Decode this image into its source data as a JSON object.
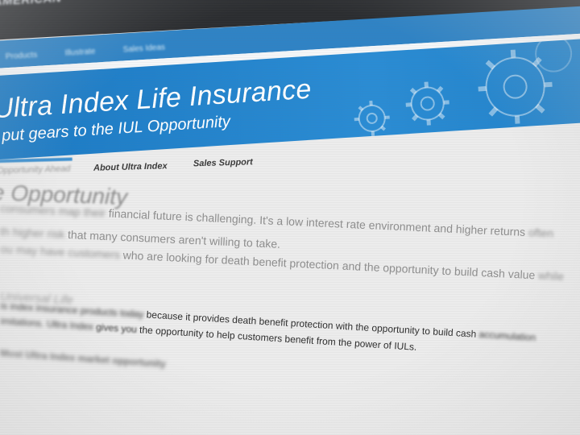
{
  "brand": {
    "logo_text": "AMERICAN"
  },
  "nav": {
    "items": [
      "Products",
      "Illustrate",
      "Sales Ideas"
    ]
  },
  "hero": {
    "title": "Ultra Index Life Insurance",
    "subtitle": "put gears to the IUL Opportunity"
  },
  "tabs": [
    {
      "label": "Opportunity Ahead",
      "active": true
    },
    {
      "label": "About Ultra Index",
      "active": false
    },
    {
      "label": "Sales Support",
      "active": false
    }
  ],
  "content": {
    "heading": "e Opportunity",
    "para1_lead": "consumers map their",
    "para1_main": " financial future is challenging. It's a low interest rate environment and higher returns",
    "para1_tail": " often",
    "para2_lead": "th higher risk",
    "para2_main": " that many consumers aren't willing to take.",
    "para3_lead": "ou may have customers",
    "para3_main": " who are looking for death benefit protection and the opportunity to build cash value",
    "para3_tail": " while",
    "subheading": "Universal Life",
    "para4_lead": "is index insurance products today",
    "para4_main": " because it provides death benefit protection with the opportunity to build cash ",
    "para4_tail": "accumulation",
    "para5_lead": "imitations. Ultra Index",
    "para5_mid": " gives you",
    "para5_main": " the opportunity to help customers benefit from the power of IULs.",
    "para6": "Most Ultra Index market opportunity"
  },
  "colors": {
    "brand_blue": "#2f83c5",
    "hero_blue": "#1a78c2",
    "dark_bar": "#2b2d30"
  }
}
